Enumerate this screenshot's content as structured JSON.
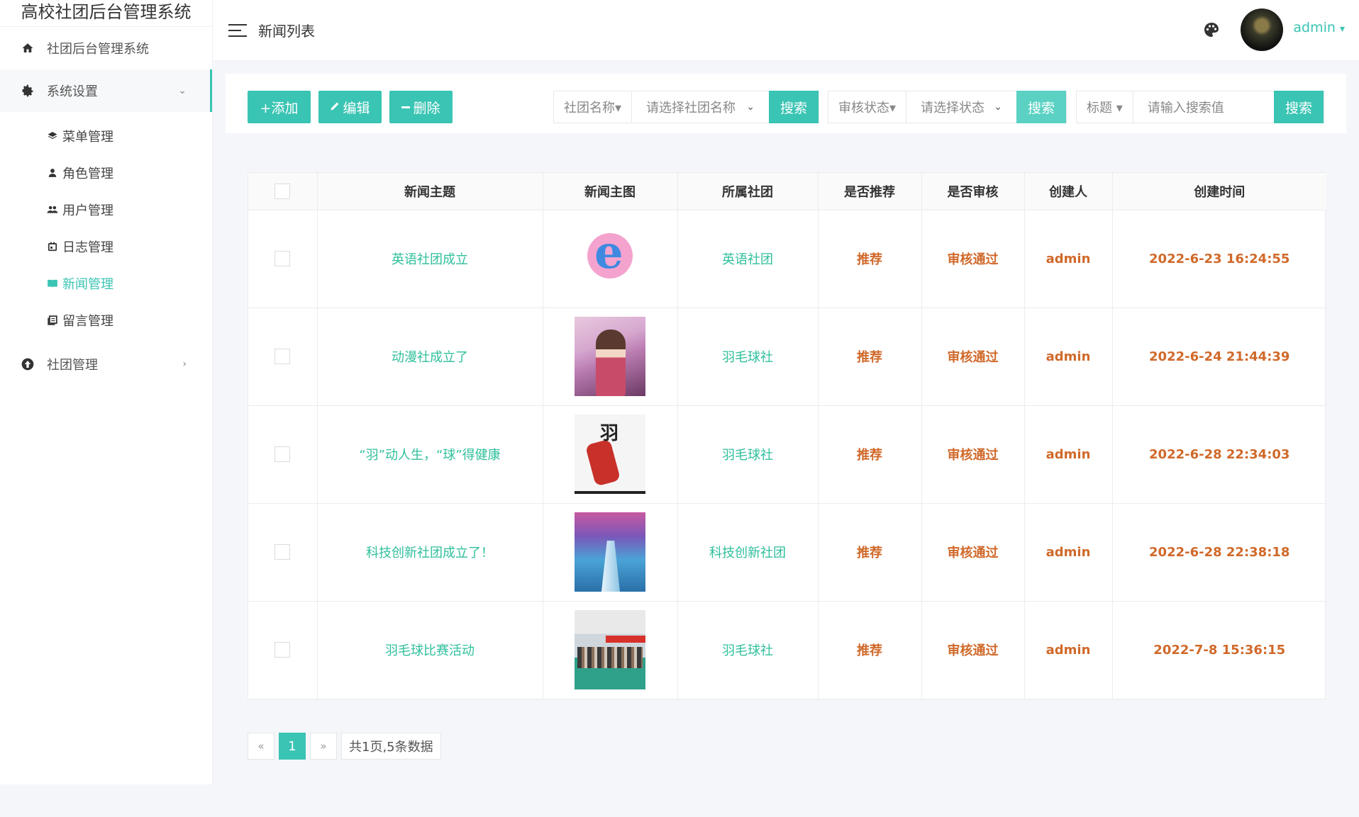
{
  "app": {
    "title": "高校社团后台管理系统"
  },
  "sidebar": {
    "home": {
      "label": "社团后台管理系统",
      "icon": "home-icon"
    },
    "settings": {
      "label": "系统设置",
      "icon": "gear-icon",
      "expanded": true,
      "items": [
        {
          "label": "菜单管理",
          "icon": "layers-icon"
        },
        {
          "label": "角色管理",
          "icon": "user-icon"
        },
        {
          "label": "用户管理",
          "icon": "users-icon"
        },
        {
          "label": "日志管理",
          "icon": "calendar-icon"
        },
        {
          "label": "新闻管理",
          "icon": "book-icon",
          "active": true
        },
        {
          "label": "留言管理",
          "icon": "message-icon"
        }
      ]
    },
    "clubs": {
      "label": "社团管理",
      "icon": "upload-icon"
    }
  },
  "header": {
    "page_title": "新闻列表",
    "username": "admin",
    "user_caret": "▾"
  },
  "toolbar": {
    "add": "+添加",
    "edit": "编辑",
    "delete": "删除",
    "filter_club": {
      "label": "社团名称▾",
      "placeholder": "请选择社团名称",
      "search": "搜索"
    },
    "filter_status": {
      "label": "审核状态▾",
      "placeholder": "请选择状态",
      "search": "搜索"
    },
    "filter_title": {
      "label": "标题 ▾",
      "placeholder": "请输入搜索值",
      "search": "搜索"
    }
  },
  "table": {
    "columns": [
      "新闻主题",
      "新闻主图",
      "所属社团",
      "是否推荐",
      "是否审核",
      "创建人",
      "创建时间"
    ],
    "rows": [
      {
        "title": "英语社团成立",
        "image": "english-club-logo",
        "club": "英语社团",
        "recommend": "推荐",
        "audit": "审核通过",
        "creator": "admin",
        "created": "2022-6-23 16:24:55"
      },
      {
        "title": "动漫社成立了",
        "image": "anime-girl-illustration",
        "club": "羽毛球社",
        "recommend": "推荐",
        "audit": "审核通过",
        "creator": "admin",
        "created": "2022-6-24 21:44:39"
      },
      {
        "title": "“羽”动人生，“球”得健康",
        "image": "badminton-poster",
        "club": "羽毛球社",
        "recommend": "推荐",
        "audit": "审核通过",
        "creator": "admin",
        "created": "2022-6-28 22:34:03"
      },
      {
        "title": "科技创新社团成立了！",
        "image": "tech-innovation-poster",
        "club": "科技创新社团",
        "recommend": "推荐",
        "audit": "审核通过",
        "creator": "admin",
        "created": "2022-6-28 22:38:18"
      },
      {
        "title": "羽毛球比赛活动",
        "image": "badminton-event-photo",
        "club": "羽毛球社",
        "recommend": "推荐",
        "audit": "审核通过",
        "creator": "admin",
        "created": "2022-7-8 15:36:15"
      }
    ]
  },
  "pagination": {
    "prev": "«",
    "current": "1",
    "next": "»",
    "summary": "共1页,5条数据"
  },
  "colors": {
    "accent": "#3ac4b3",
    "link": "#2fbf9c",
    "status": "#d0692a"
  }
}
